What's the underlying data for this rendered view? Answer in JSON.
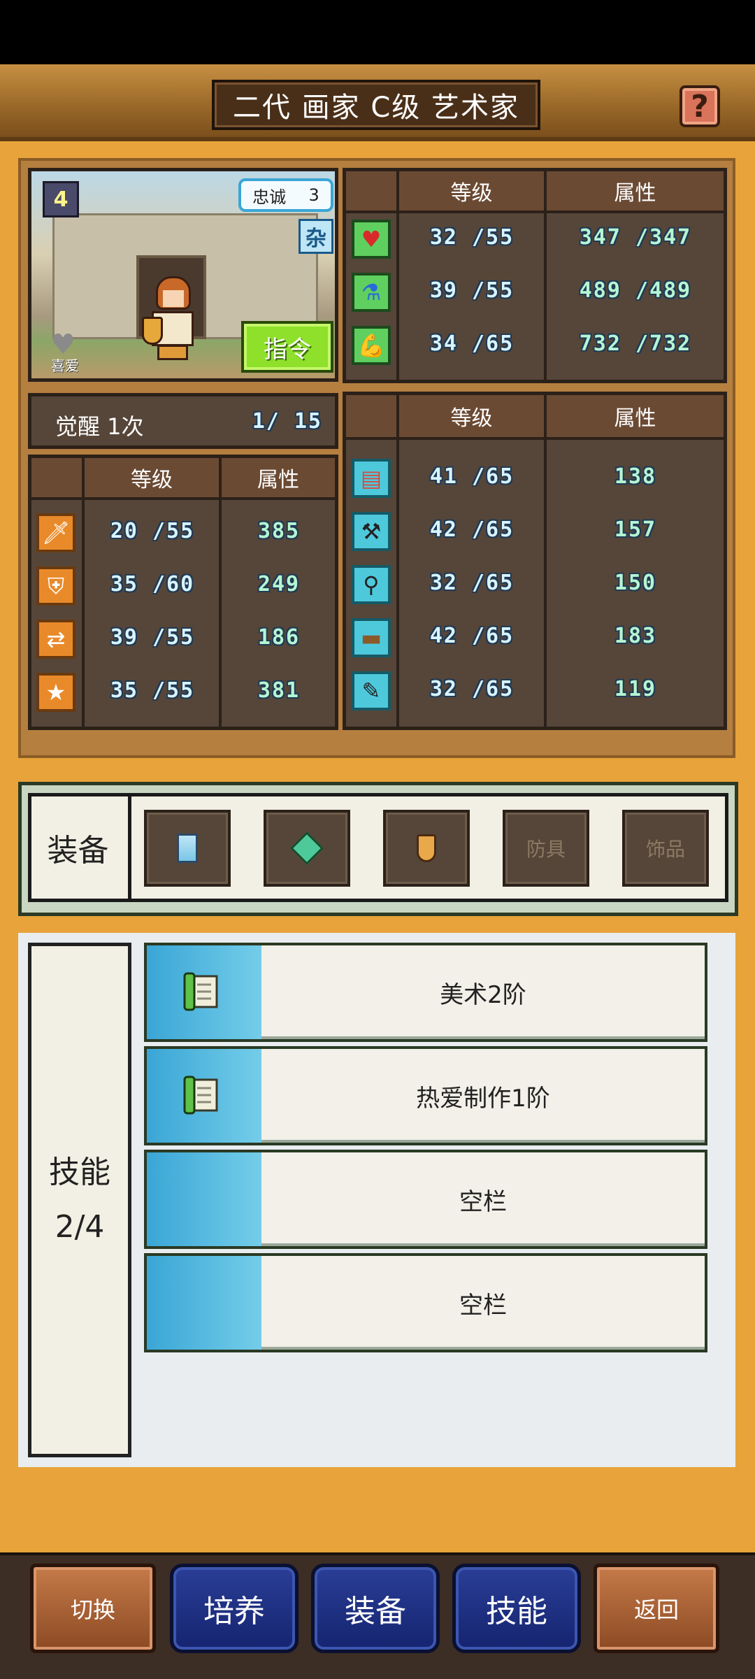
{
  "header": {
    "title": "二代 画家 C级 艺术家",
    "help_icon_text": "?"
  },
  "portrait": {
    "level_badge": "4",
    "loyalty_label": "忠诚",
    "loyalty_value": "3",
    "misc_label": "杂",
    "like_label": "喜爱",
    "command_label": "指令"
  },
  "vitals_table": {
    "col_level": "等级",
    "col_attr": "属性",
    "rows": [
      {
        "icon": "heart-icon",
        "level": "32 /55",
        "attr": "347 /347"
      },
      {
        "icon": "potion-icon",
        "level": "39 /55",
        "attr": "489 /489"
      },
      {
        "icon": "muscle-icon",
        "level": "34 /65",
        "attr": "732 /732"
      }
    ]
  },
  "awakening": {
    "label": "觉醒 1次",
    "count": "1/ 15"
  },
  "combat_table": {
    "col_level": "等级",
    "col_attr": "属性",
    "rows": [
      {
        "icon": "sword-icon",
        "level": "20 /55",
        "attr": "385"
      },
      {
        "icon": "shield-icon",
        "level": "35 /60",
        "attr": "249"
      },
      {
        "icon": "arrows-icon",
        "level": "39 /55",
        "attr": "186"
      },
      {
        "icon": "star-icon",
        "level": "35 /55",
        "attr": "381"
      }
    ]
  },
  "craft_table": {
    "col_level": "等级",
    "col_attr": "属性",
    "rows": [
      {
        "icon": "book-icon",
        "level": "41 /65",
        "attr": "138"
      },
      {
        "icon": "hammer-icon",
        "level": "42 /65",
        "attr": "157"
      },
      {
        "icon": "shovel-icon",
        "level": "32 /65",
        "attr": "150"
      },
      {
        "icon": "anvil-icon",
        "level": "42 /65",
        "attr": "183"
      },
      {
        "icon": "brush-icon",
        "level": "32 /65",
        "attr": "119"
      }
    ]
  },
  "equipment": {
    "label": "装备",
    "slots": [
      {
        "icon": "paint-can-icon",
        "label": ""
      },
      {
        "icon": "gem-icon",
        "label": ""
      },
      {
        "icon": "amulet-icon",
        "label": ""
      },
      {
        "icon": "",
        "label": "防具"
      },
      {
        "icon": "",
        "label": "饰品"
      }
    ]
  },
  "skills": {
    "label": "技能",
    "count": "2/4",
    "rows": [
      {
        "icon": "scroll-icon",
        "name": "美术2阶"
      },
      {
        "icon": "scroll-icon",
        "name": "热爱制作1阶"
      },
      {
        "icon": "",
        "name": "空栏"
      },
      {
        "icon": "",
        "name": "空栏"
      }
    ]
  },
  "bottom_nav": {
    "switch": "切换",
    "train": "培养",
    "equip": "装备",
    "skill": "技能",
    "back": "返回"
  }
}
